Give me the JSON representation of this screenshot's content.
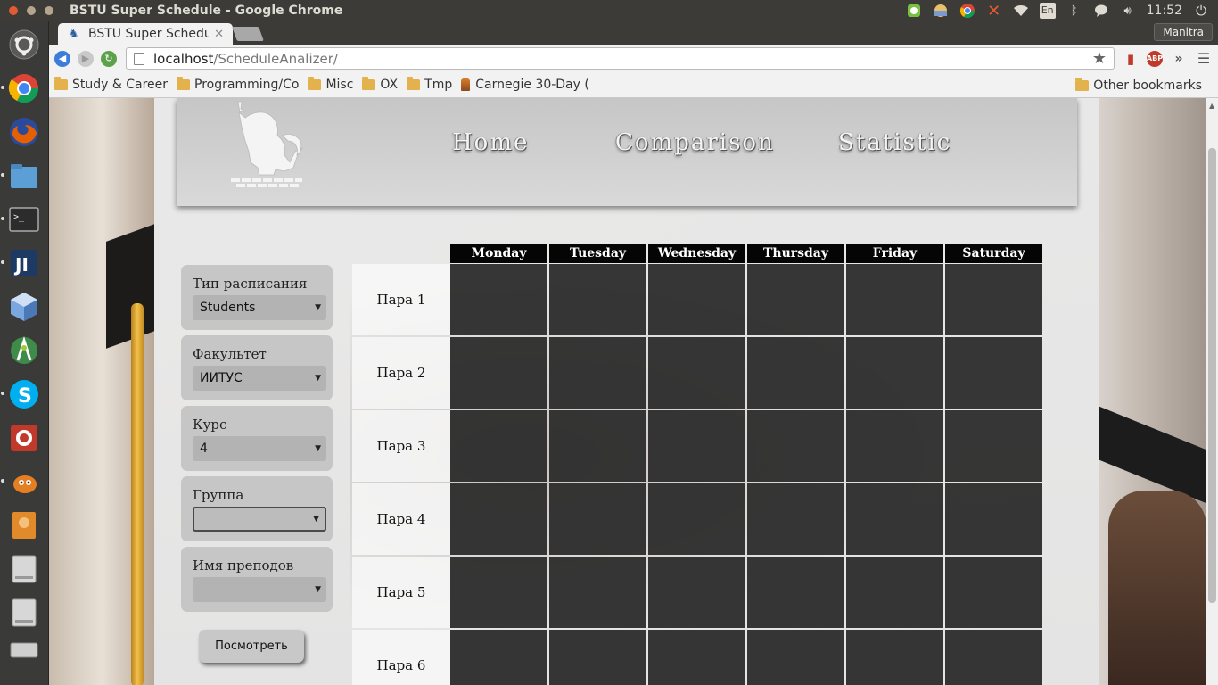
{
  "system": {
    "window_title": "BSTU Super Schedule - Google Chrome",
    "keyboard_layout": "En",
    "clock": "11:52"
  },
  "browser": {
    "tab_title": "BSTU Super Schedul",
    "profile_name": "Manitra",
    "url_host": "localhost",
    "url_path": "/ScheduleAnalizer/",
    "bookmarks": [
      {
        "label": "Study & Career",
        "type": "folder"
      },
      {
        "label": "Programming/Co",
        "type": "folder"
      },
      {
        "label": "Misc",
        "type": "folder"
      },
      {
        "label": "OX",
        "type": "folder"
      },
      {
        "label": "Tmp",
        "type": "folder"
      },
      {
        "label": "Carnegie 30-Day (",
        "type": "link"
      }
    ],
    "other_bookmarks": "Other bookmarks",
    "abp_label": "ABP"
  },
  "page": {
    "nav": {
      "home": "Home",
      "comparison": "Comparison",
      "statistic": "Statistic"
    },
    "filters": [
      {
        "label": "Тип расписания",
        "value": "Students"
      },
      {
        "label": "Факультет",
        "value": "ИИТУС"
      },
      {
        "label": "Курс",
        "value": "4"
      },
      {
        "label": "Группа",
        "value": ""
      },
      {
        "label": "Имя преподов",
        "value": ""
      }
    ],
    "view_button": "Посмотреть",
    "schedule": {
      "days": [
        "Monday",
        "Tuesday",
        "Wednesday",
        "Thursday",
        "Friday",
        "Saturday"
      ],
      "periods": [
        "Пара 1",
        "Пара 2",
        "Пара 3",
        "Пара 4",
        "Пара 5",
        "Пара 6"
      ]
    }
  },
  "launcher_icons": [
    "dash-icon",
    "chromium-icon",
    "firefox-icon",
    "files-icon",
    "terminal-icon",
    "intellij-icon",
    "virtualbox-icon",
    "android-studio-icon",
    "skype-icon",
    "software-updater-icon",
    "gimp-icon",
    "disk-icon",
    "drive-icon",
    "drive-icon",
    "usb-drive-icon",
    "trash-icon"
  ]
}
